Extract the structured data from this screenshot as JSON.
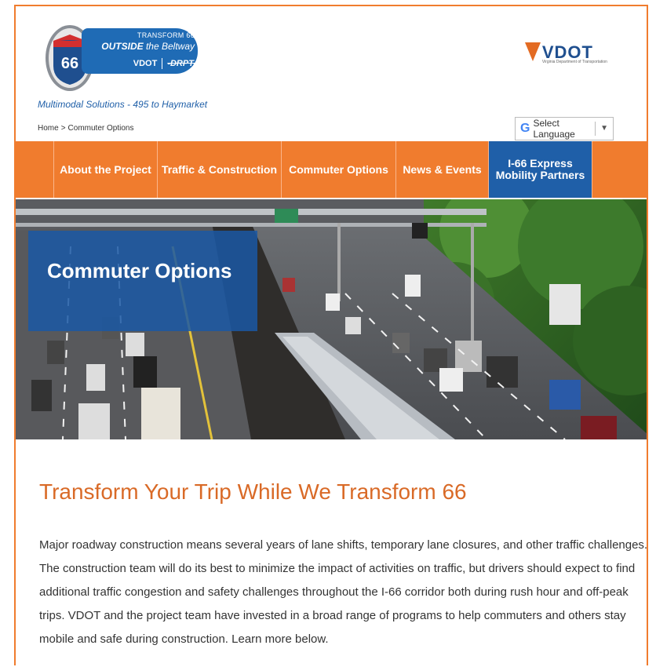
{
  "logo": {
    "shield_number": "66",
    "banner_line1": "TRANSFORM 66",
    "banner_line2_bold": "OUTSIDE",
    "banner_line2_rest": " the Beltway",
    "banner_vdot": "VDOT",
    "banner_partner": "-DRPT-",
    "tagline": "Multimodal Solutions - 495 to Haymarket"
  },
  "vdot_logo": {
    "text": "VDOT",
    "subtitle": "Virginia Department of Transportation"
  },
  "breadcrumb": {
    "home": "Home",
    "separator": ">",
    "current": "Commuter Options"
  },
  "language": {
    "label": "Select Language",
    "arrow": "▼",
    "icon": "google-g-icon"
  },
  "nav": {
    "items": [
      "About the Project",
      "Traffic & Construction",
      "Commuter Options",
      "News & Events"
    ],
    "express": {
      "line1": "I-66 Express",
      "line2": "Mobility Partners"
    }
  },
  "hero": {
    "title": "Commuter Options"
  },
  "content": {
    "heading": "Transform Your Trip While We Transform 66",
    "lines": [
      "Major roadway construction means several years of lane shifts, temporary lane closures, and other traffic challenges.",
      "The construction team will do its best to minimize the impact of activities on traffic, but drivers should expect to find",
      "additional traffic congestion and safety challenges throughout the I-66 corridor both during rush hour and off-peak",
      "trips. VDOT and the project team have invested in a broad range of programs to help commuters and others stay",
      "mobile and safe during construction. Learn more below."
    ]
  },
  "colors": {
    "accent": "#f07c2e",
    "brand_blue": "#1f5fa8",
    "heading": "#d96a27"
  }
}
